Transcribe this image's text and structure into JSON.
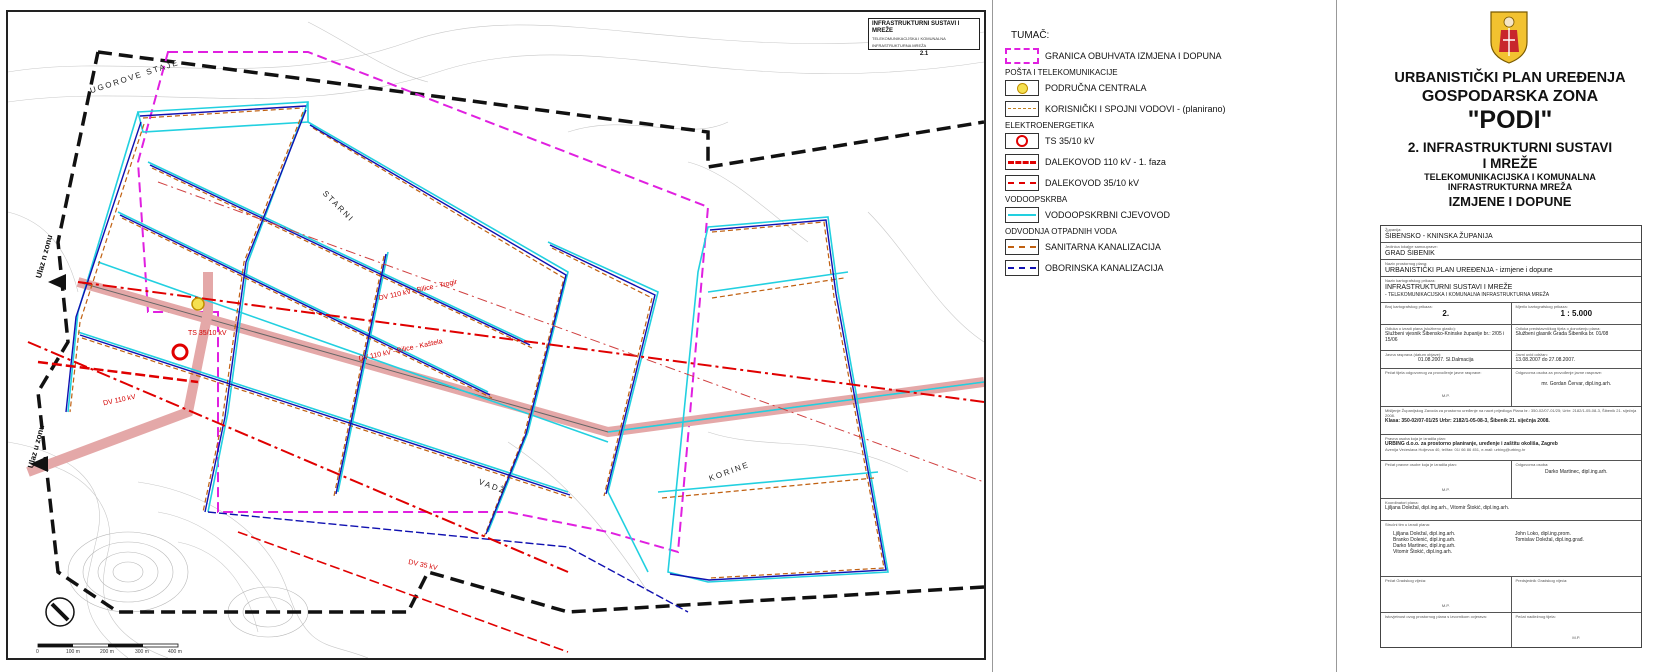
{
  "map": {
    "corner_title_line1": "INFRASTRUKTURNI SUSTAVI I MREŽE",
    "corner_title_line2": "TELEKOMUNIKACIJSKA I KOMUNALNA INFRASTRUKTURNA MREŽA",
    "corner_title_number": "2.1",
    "place_labels": [
      "UGOROVE STAJE",
      "STARNI",
      "VADŽ",
      "KORINE"
    ],
    "road_in_label": "Ulaz u zonu",
    "road_in_label2": "Ulaz n zonu",
    "line_labels": [
      "DV 110 kV - Bilice - Trogir",
      "DV 110 kV - Bilice - Kaštela",
      "DV 110 kV",
      "DV 35 kV"
    ],
    "ts_label": "TS 35/10 kV",
    "scale_ticks": [
      "0",
      "100 m",
      "200 m",
      "300 m",
      "400 m"
    ],
    "colors": {
      "boundary": "#e020e0",
      "water": "#22d0e0",
      "sanitary": "#c06010",
      "storm": "#1010b0",
      "power110": "#e00000",
      "road_band": "#e4a8a8"
    }
  },
  "legend": {
    "title": "TUMAČ:",
    "boundary": "GRANICA OBUHVATA IZMJENA I DOPUNA",
    "group_post": "POŠTA I TELEKOMUNIKACIJE",
    "central": "PODRUČNA CENTRALA",
    "user_lines": "KORISNIČKI I SPOJNI VODOVI - (planirano)",
    "group_elec": "ELEKTROENERGETIKA",
    "ts": "TS 35/10 kV",
    "dv110": "DALEKOVOD 110 kV - 1. faza",
    "dv35": "DALEKOVOD 35/10 kV",
    "group_water": "VODOOPSKRBA",
    "water_pipe": "VODOOPSKRBNI CJEVOVOD",
    "group_waste": "ODVODNJA OTPADNIH VODA",
    "sanitary": "SANITARNA KANALIZACIJA",
    "storm": "OBORINSKA KANALIZACIJA"
  },
  "title": {
    "line1": "URBANISTIČKI PLAN UREĐENJA",
    "line2": "GOSPODARSKA ZONA",
    "line3": "\"PODI\"",
    "line4": "2. INFRASTRUKTURNI SUSTAVI",
    "line5": "I MREŽE",
    "line6": "TELEKOMUNIKACIJSKA I KOMUNALNA",
    "line7": "INFRASTRUKTURNA MREŽA",
    "line8": "IZMJENE I DOPUNE"
  },
  "table": {
    "county_cap": "Županija:",
    "county": "ŠIBENSKO - KNINSKA ŽUPANIJA",
    "city_cap": "Jedinica lokalne samouprave:",
    "city": "GRAD ŠIBENIK",
    "plan_cap": "Naziv prostornog plana:",
    "plan": "URBANISTIČKI PLAN UREĐENJA - izmjene i dopune",
    "sheet_cap": "Naziv kartografskog prikaza:",
    "sheet": "INFRASTRUKTURNI SUSTAVI I MREŽE",
    "sheet_sub": "- TELEKOMUNIKACIJSKA I KOMUNALNA INFRASTRUKTURNA MREŽA",
    "num_cap": "Broj kartografskog prikaza:",
    "num": "2.",
    "scale_cap": "Mjerilo kartografskog prikaza:",
    "scale": "1 : 5.000",
    "gaz_cap": "Odluka o izradi plana (službeno glasilo):",
    "gaz": "Službeni vjesnik Šibensko-Kninske županije br.: 2/05 i 15/06",
    "gaz2_cap": "Odluka predstavničkog tijela o donošenju plana:",
    "gaz2": "Službeni glasnik Grada Šibenika br. 01/08",
    "pub_cap": "Javna rasprava (datum objave):",
    "pub": "01.08.2007. Sl.Dalmacija",
    "insp_cap": "Javni uvid održan:",
    "insp": "13.08.2007 do 27.08.2007.",
    "seal_cap": "Pečat tijela odgovornog za provođenje javne rasprave:",
    "resp_cap": "Odgovorna osoba za provođenje javne rasprave:",
    "resp": "mr. Gordan Červar, dipl.ing.arh.",
    "mp": "M.P.",
    "consent1": "Mišljenje Županijskog Zavoda za prostorno uređenje na nacrt prijedloga Plana br.: 350-02/07-01/25; Urbr: 2182/1-05-08-3, Šibenik 21. siječnja 2008.",
    "consent2": "Klasa: 350-02/07-01/25 Urbr: 2182/1-05-08-3, Šibenik 21. siječnja 2008.",
    "maker_cap": "Pravna osoba koja je izradila plan:",
    "maker": "URBING d.o.o. za prostorno planiranje, uređenje i zaštitu okoliša, Zagreb",
    "maker2": "Avenija Većeslava Holjevca 40, tel/fax: 01/ 66 86 451, e-mail: urbing@urbing.hr",
    "seal2_cap": "Pečat pravne osobe koja je izradila plan:",
    "resp2_cap": "Odgovorna osoba:",
    "resp2": "Darko Martinec, dipl.ing.arh.",
    "coord_cap": "Koordinatori plana:",
    "coord": "Ljiljana Doležal, dipl.ing.arh., Vitomir Štokić, dipl.ing.arh.",
    "team_cap": "Stručni tim u izradi plana:",
    "team_left": [
      "Ljiljana Doležal, dipl.ing.arh.",
      "Branko Dolenić, dipl.ing.arh.",
      "Darko Martinec, dipl.ing.arh.",
      "Vitomir Štokić, dipl.ing.arh."
    ],
    "team_right": [
      "John Loko, dipl.ing.prom.",
      "Tomislav Doležal, dipl.ing.građ."
    ],
    "seal3_cap": "Pečat Gradskog vijeća:",
    "pres_cap": "Predsjednik Gradskog vijeća:",
    "reg_cap": "Istovjetnost ovog prostornog plana s izvornikom ovjerava:",
    "reg2_cap": "Pečat nadležnog tijela:"
  }
}
